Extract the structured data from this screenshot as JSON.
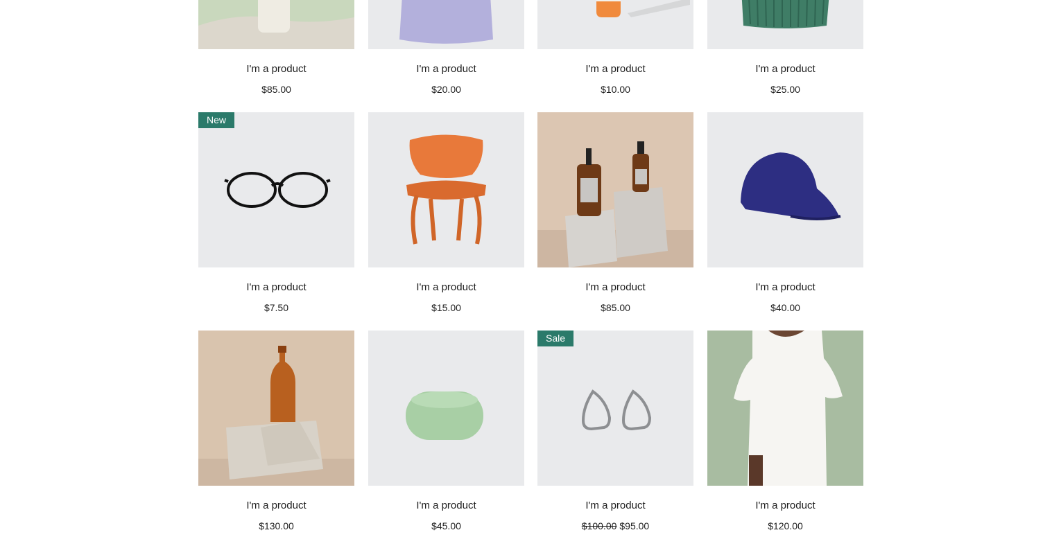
{
  "products": [
    {
      "name": "I'm a product",
      "price": "$85.00",
      "image": "cream-bottle-on-stone"
    },
    {
      "name": "I'm a product",
      "price": "$20.00",
      "image": "lavender-pouch"
    },
    {
      "name": "I'm a product",
      "price": "$10.00",
      "image": "orange-dropper-bottle"
    },
    {
      "name": "I'm a product",
      "price": "$25.00",
      "image": "green-knit-beanie"
    },
    {
      "name": "I'm a product",
      "price": "$7.50",
      "image": "black-eyeglasses",
      "ribbon": "New"
    },
    {
      "name": "I'm a product",
      "price": "$15.00",
      "image": "orange-wooden-chair"
    },
    {
      "name": "I'm a product",
      "price": "$85.00",
      "image": "amber-pump-bottles"
    },
    {
      "name": "I'm a product",
      "price": "$40.00",
      "image": "navy-baseball-cap"
    },
    {
      "name": "I'm a product",
      "price": "$130.00",
      "image": "copper-water-bottle"
    },
    {
      "name": "I'm a product",
      "price": "$45.00",
      "image": "green-soap-bar"
    },
    {
      "name": "I'm a product",
      "original_price": "$100.00",
      "price": "$95.00",
      "image": "silver-hoop-earrings",
      "ribbon": "Sale"
    },
    {
      "name": "I'm a product",
      "price": "$120.00",
      "image": "white-tshirt-model"
    }
  ],
  "colors": {
    "ribbon": "#2b7a6a",
    "card_bg": "#e9eaec",
    "text": "#1e1e1e"
  }
}
